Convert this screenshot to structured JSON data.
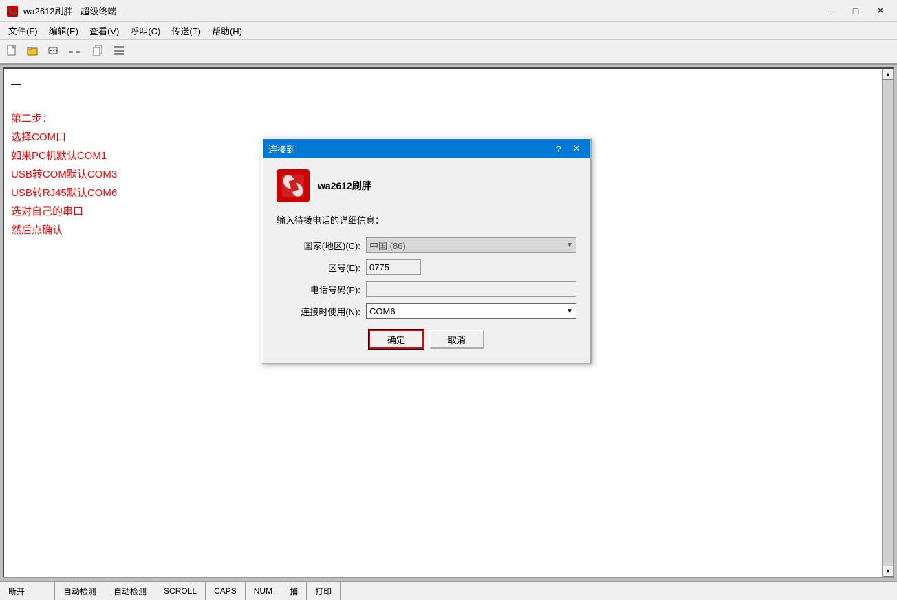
{
  "window": {
    "title": "wa2612刷胖 - 超级终端",
    "icon": "📞"
  },
  "titlebar": {
    "minimize_label": "—",
    "maximize_label": "□",
    "close_label": "✕"
  },
  "menu": {
    "items": [
      {
        "id": "file",
        "label": "文件(F)"
      },
      {
        "id": "edit",
        "label": "编辑(E)"
      },
      {
        "id": "view",
        "label": "查看(V)"
      },
      {
        "id": "call",
        "label": "呼叫(C)"
      },
      {
        "id": "transfer",
        "label": "传送(T)"
      },
      {
        "id": "help",
        "label": "帮助(H)"
      }
    ]
  },
  "toolbar": {
    "buttons": [
      {
        "id": "new",
        "icon": "📄"
      },
      {
        "id": "open",
        "icon": "📂"
      },
      {
        "id": "modem",
        "icon": "📟"
      },
      {
        "id": "disconnect",
        "icon": "✂"
      },
      {
        "id": "copy_paste",
        "icon": "📋"
      },
      {
        "id": "extra",
        "icon": "📰"
      }
    ]
  },
  "terminal": {
    "content_lines": [
      "第二步：",
      "选择COM口",
      "如果PC机默认COM1",
      "USB转COM默认COM3",
      "USB转RJ45默认COM6",
      "选对自己的串口",
      "然后点确认"
    ],
    "dash": "—"
  },
  "dialog": {
    "title": "连接到",
    "help_btn": "?",
    "close_btn": "✕",
    "app_icon": "phone",
    "app_name": "wa2612刷胖",
    "subtitle": "输入待拨电话的详细信息：",
    "fields": {
      "country_label": "国家(地区)(C):",
      "country_value": "中国 (86)",
      "area_label": "区号(E):",
      "area_value": "0775",
      "phone_label": "电话号码(P):",
      "phone_value": "",
      "connect_label": "连接时使用(N):",
      "connect_value": "COM6"
    },
    "buttons": {
      "ok": "确定",
      "cancel": "取消"
    }
  },
  "statusbar": {
    "items": [
      {
        "id": "disconnect",
        "label": "断开"
      },
      {
        "id": "autodetect1",
        "label": "自动检测"
      },
      {
        "id": "autodetect2",
        "label": "自动检测"
      },
      {
        "id": "scroll",
        "label": "SCROLL"
      },
      {
        "id": "caps",
        "label": "CAPS"
      },
      {
        "id": "num",
        "label": "NUM"
      },
      {
        "id": "capture",
        "label": "捕"
      },
      {
        "id": "print",
        "label": "打印"
      }
    ]
  }
}
